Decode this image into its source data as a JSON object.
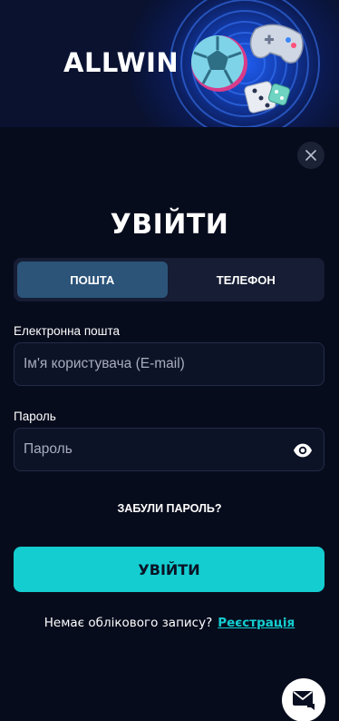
{
  "banner": {
    "brand": "ALLWIN",
    "icons": [
      "soccer-ball",
      "gamepad",
      "dice"
    ]
  },
  "modal": {
    "close_icon": "close-icon",
    "title": "УВІЙТИ",
    "tabs": [
      {
        "label": "ПОШТА",
        "active": true
      },
      {
        "label": "ТЕЛЕФОН",
        "active": false
      }
    ],
    "email": {
      "label": "Електронна пошта",
      "placeholder": "Ім'я користувача (E-mail)",
      "value": ""
    },
    "password": {
      "label": "Пароль",
      "placeholder": "Пароль",
      "value": "",
      "toggle_icon": "eye-icon"
    },
    "forgot_label": "ЗАБУЛИ ПАРОЛЬ?",
    "submit_label": "УВІЙТИ",
    "signup_prompt": "Немає облікового запису?",
    "signup_link": "Реєстрація"
  },
  "chat": {
    "icon": "chat-envelope-icon"
  },
  "colors": {
    "background": "#070c1d",
    "accent": "#14cdd0",
    "active_tab": "#2c5479",
    "field_border": "#232c47"
  }
}
